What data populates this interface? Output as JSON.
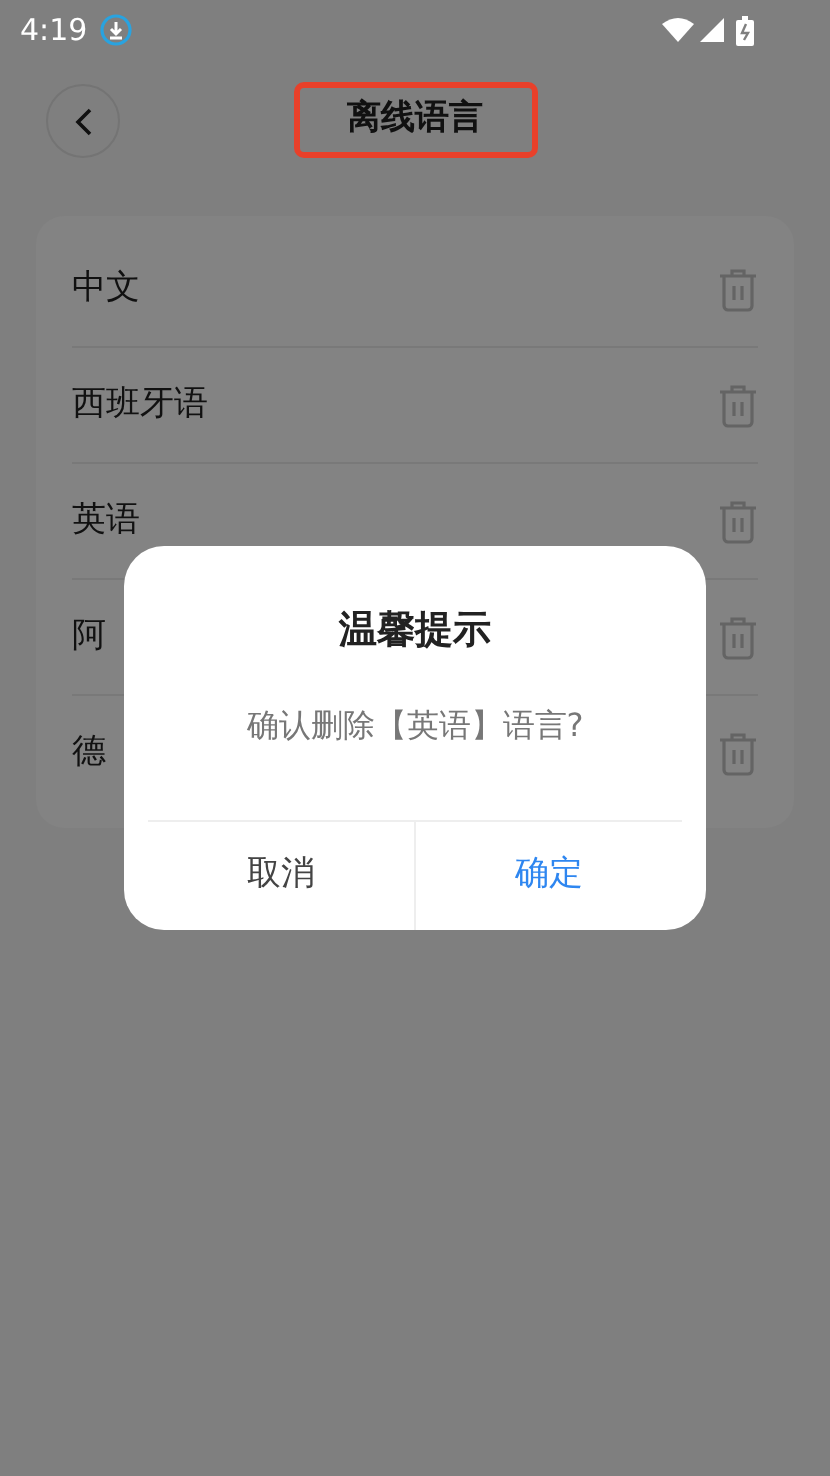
{
  "status_bar": {
    "time": "4:19"
  },
  "header": {
    "title": "离线语言",
    "title_highlighted": true
  },
  "languages": [
    {
      "name": "中文"
    },
    {
      "name": "西班牙语"
    },
    {
      "name": "英语"
    },
    {
      "name": "阿"
    },
    {
      "name": "德"
    }
  ],
  "dialog": {
    "title": "温馨提示",
    "message": "确认删除【英语】语言?",
    "buttons": [
      {
        "label": "取消",
        "kind": "cancel"
      },
      {
        "label": "确定",
        "kind": "confirm"
      }
    ]
  }
}
